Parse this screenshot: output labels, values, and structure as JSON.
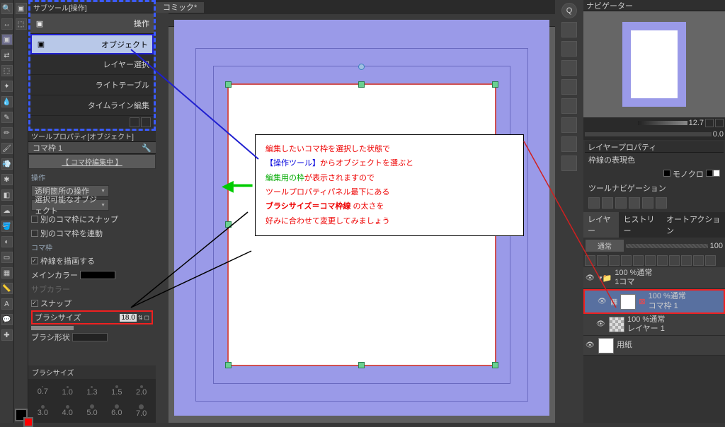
{
  "canvas_tab": "コミック*",
  "subtool": {
    "panel_title": "サブツール[操作]",
    "items": [
      "操作",
      "オブジェクト",
      "レイヤー選択",
      "ライトテーブル",
      "タイムライン編集"
    ]
  },
  "toolprop": {
    "panel_title": "ツールプロパティ[オブジェクト]",
    "tab": "コマ枠 1",
    "header": "【 コマ枠編集中 】",
    "sec_ops": "操作",
    "transparent_dd": "透明箇所の操作",
    "selectable_dd": "選択可能なオブジェクト",
    "snap_other_cb": "別のコマ枠にスナップ",
    "link_other_cb": "別のコマ枠を連動",
    "sec_koma": "コマ枠",
    "draw_border_cb": "枠線を描画する",
    "main_color": "メインカラー",
    "sub_color": "サブカラー",
    "snap_cb": "スナップ",
    "brush_size_label": "ブラシサイズ",
    "brush_size_val": "18.0",
    "brush_shape": "ブラシ形状"
  },
  "brush_sizes_label": "ブラシサイズ",
  "brush_sizes": [
    "0.7",
    "1.0",
    "1.3",
    "1.5",
    "2.0",
    "3.0",
    "4.0",
    "5.0",
    "6.0",
    "7.0"
  ],
  "tutorial": {
    "l1": "編集したいコマ枠を選択した状態で",
    "l2a": "【操作ツール】",
    "l2b": "からオブジェクトを選ぶと",
    "l3a": "編集用の枠",
    "l3b": "が表示されますので",
    "l4": "ツールプロパティパネル最下にある",
    "l5a": "ブラシサイズ＝コマ枠線",
    "l5b": " の太さを",
    "l6": "好みに合わせて変更してみましょう"
  },
  "nav": {
    "title": "ナビゲーター",
    "zoom": "12.7"
  },
  "layer_prop": {
    "title": "レイヤープロパティ",
    "border_color": "枠線の表現色",
    "mode": "モノクロ",
    "tool_nav": "ツールナビゲーション"
  },
  "layer_panel": {
    "tabs": [
      "レイヤー",
      "ヒストリー",
      "オートアクション"
    ],
    "blend": "通常",
    "opacity": "100",
    "folder": {
      "opa": "100 %通常",
      "name": "1コマ"
    },
    "koma_layer": {
      "opa": "100 %通常",
      "name": "コマ枠 1"
    },
    "layer1": {
      "opa": "100 %通常",
      "name": "レイヤー 1"
    },
    "paper": {
      "name": "用紙"
    }
  }
}
